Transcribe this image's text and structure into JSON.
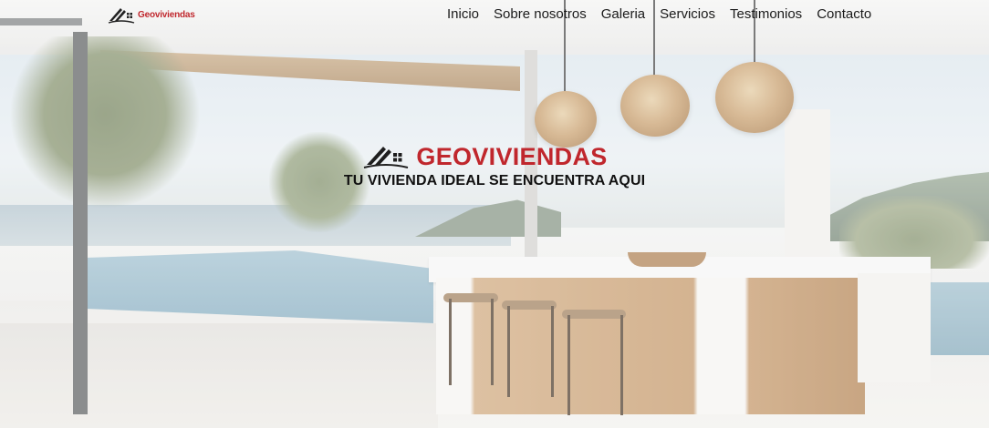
{
  "header": {
    "logo_text": "Geoviviendas",
    "nav": [
      {
        "label": "Inicio"
      },
      {
        "label": "Sobre nosotros"
      },
      {
        "label": "Galeria"
      },
      {
        "label": "Servicios"
      },
      {
        "label": "Testimonios"
      },
      {
        "label": "Contacto"
      }
    ]
  },
  "hero": {
    "brand_title": "GEOVIVIENDAS",
    "tagline": "TU VIVIENDA IDEAL SE ENCUENTRA AQUI"
  },
  "colors": {
    "brand_red": "#c0272d",
    "nav_text": "#1a1a1a",
    "tagline_text": "#111111"
  },
  "icons": {
    "logo_icon": "house-roof-logo-icon"
  }
}
